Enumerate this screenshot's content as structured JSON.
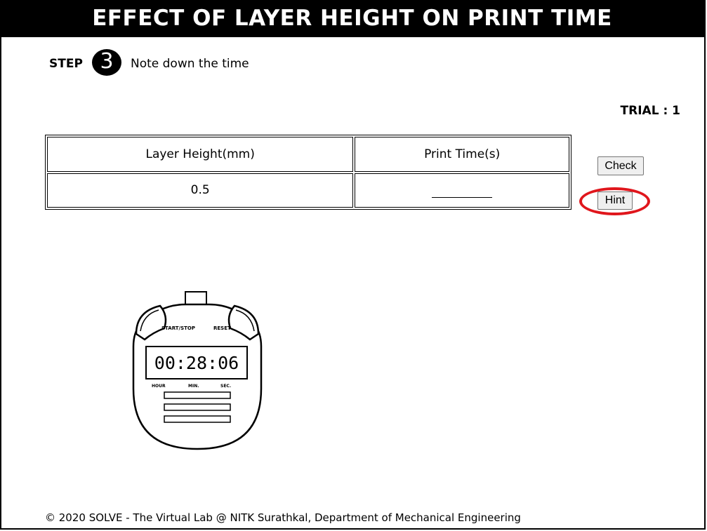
{
  "header": {
    "title": "EFFECT OF LAYER HEIGHT ON PRINT TIME"
  },
  "step": {
    "label": "STEP",
    "number": "3",
    "instruction": "Note down the time"
  },
  "trial": {
    "text": "TRIAL : 1"
  },
  "table": {
    "headers": [
      "Layer Height(mm)",
      "Print Time(s)"
    ],
    "rows": [
      [
        "0.5",
        ""
      ]
    ]
  },
  "buttons": {
    "check_label": "Check",
    "hint_label": "Hint"
  },
  "stopwatch": {
    "start_stop_label": "START/STOP",
    "reset_label": "RESET",
    "display_time": "00:28:06",
    "hour_label": "HOUR",
    "min_label": "MIN.",
    "sec_label": "SEC."
  },
  "footer": {
    "text": "© 2020 SOLVE - The Virtual Lab @ NITK Surathkal, Department of Mechanical Engineering"
  },
  "colors": {
    "highlight_ring": "#e0161c",
    "title_bg": "#000000",
    "title_fg": "#ffffff"
  }
}
